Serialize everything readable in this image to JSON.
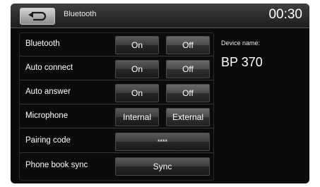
{
  "header": {
    "back_label": "Back",
    "title": "Bluetooth",
    "clock": "00:30"
  },
  "settings": [
    {
      "label": "Bluetooth",
      "options": [
        "On",
        "Off"
      ]
    },
    {
      "label": "Auto connect",
      "options": [
        "On",
        "Off"
      ]
    },
    {
      "label": "Auto answer",
      "options": [
        "On",
        "Off"
      ]
    },
    {
      "label": "Microphone",
      "options": [
        "Internal",
        "External"
      ]
    },
    {
      "label": "Pairing code",
      "value": "****"
    },
    {
      "label": "Phone book sync",
      "action": "Sync"
    }
  ],
  "device": {
    "label": "Device name:",
    "name": "BP 370"
  }
}
